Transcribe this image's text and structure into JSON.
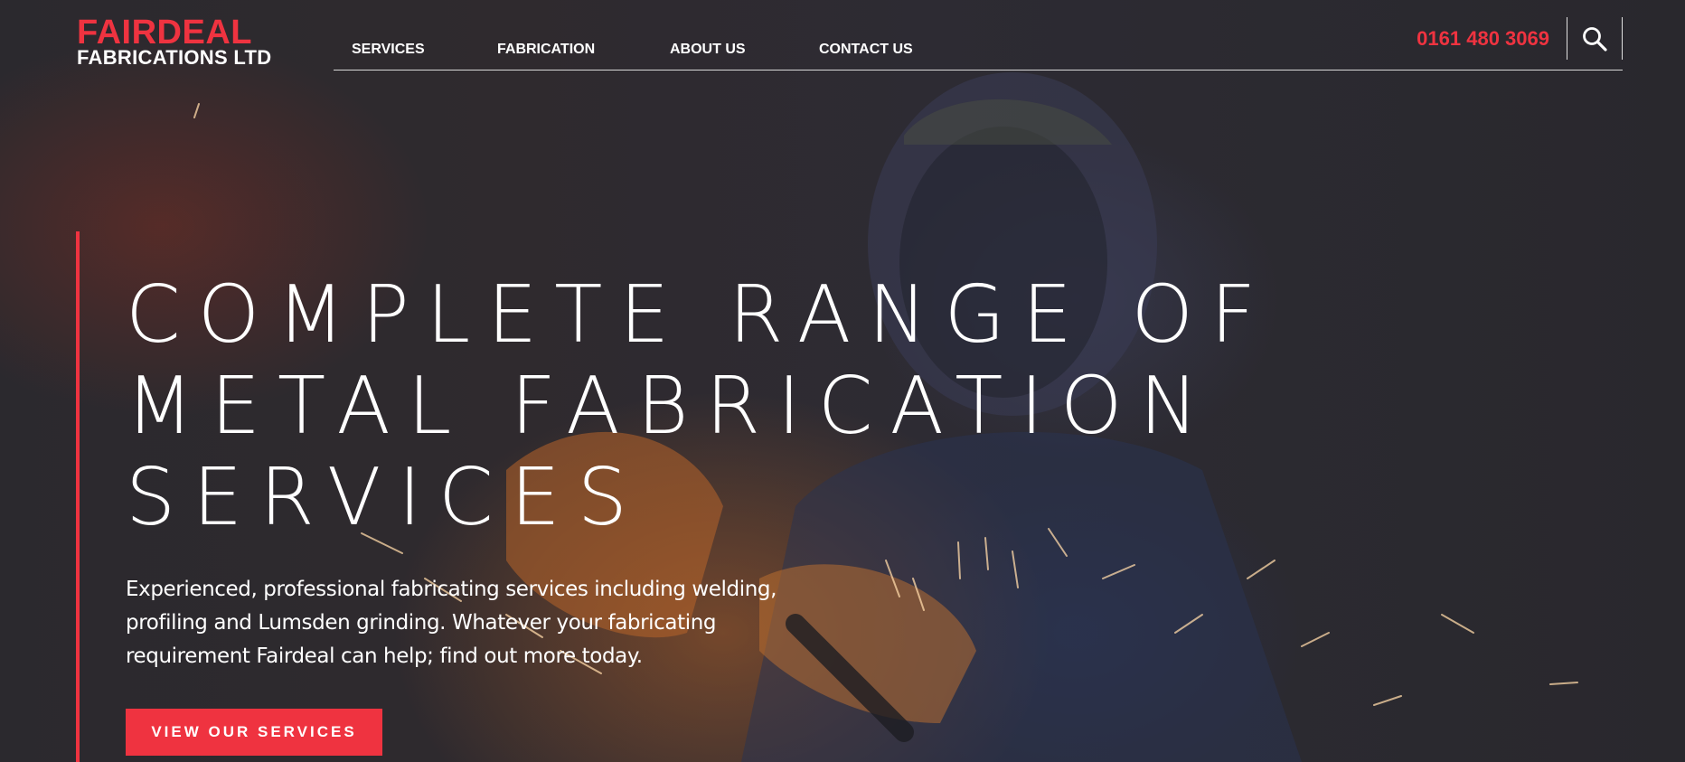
{
  "logo": {
    "line1": "FAIRDEAL",
    "line2": "FABRICATIONS LTD"
  },
  "nav": {
    "items": [
      {
        "label": "SERVICES"
      },
      {
        "label": "FABRICATION"
      },
      {
        "label": "ABOUT US"
      },
      {
        "label": "CONTACT US"
      }
    ]
  },
  "header": {
    "phone": "0161 480 3069",
    "search_icon": "search-icon"
  },
  "hero": {
    "headline_lines": [
      "COMPLETE RANGE OF",
      "METAL FABRICATION",
      "SERVICES"
    ],
    "intro_lines": [
      "Experienced, professional fabricating services including welding,",
      "profiling and Lumsden grinding. Whatever your fabricating",
      "requirement Fairdeal can help; find out more today."
    ],
    "cta_label": "VIEW OUR SERVICES",
    "background_image": "welder-with-sparks-photo"
  },
  "colors": {
    "accent": "#ef3340",
    "background": "#2a282d",
    "text": "#ffffff"
  }
}
